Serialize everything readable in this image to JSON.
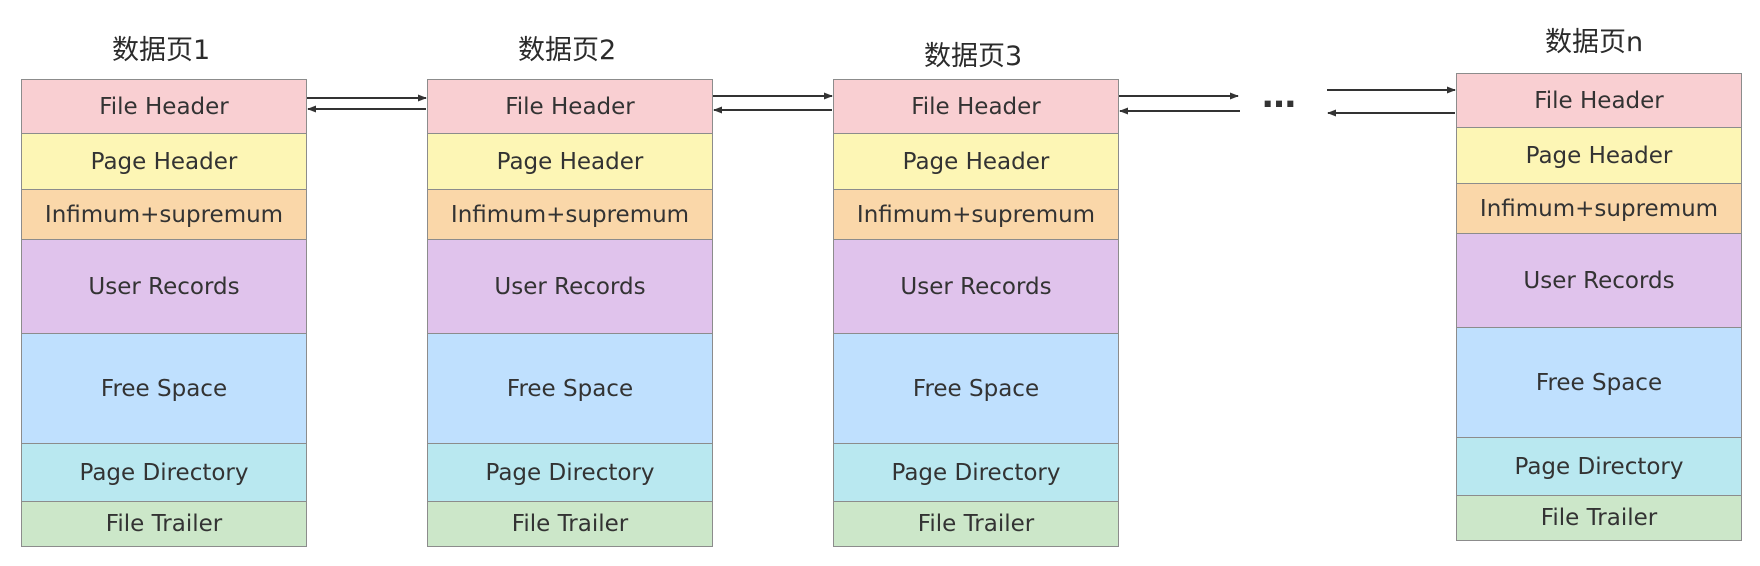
{
  "pages": [
    {
      "title": "数据页1",
      "sections": {
        "file_header": "File Header",
        "page_header": "Page Header",
        "infimum_supremum": "Infimum+supremum",
        "user_records": "User Records",
        "free_space": "Free Space",
        "page_directory": "Page Directory",
        "file_trailer": "File Trailer"
      }
    },
    {
      "title": "数据页2",
      "sections": {
        "file_header": "File Header",
        "page_header": "Page Header",
        "infimum_supremum": "Infimum+supremum",
        "user_records": "User Records",
        "free_space": "Free Space",
        "page_directory": "Page Directory",
        "file_trailer": "File Trailer"
      }
    },
    {
      "title": "数据页3",
      "sections": {
        "file_header": "File Header",
        "page_header": "Page Header",
        "infimum_supremum": "Infimum+supremum",
        "user_records": "User Records",
        "free_space": "Free Space",
        "page_directory": "Page Directory",
        "file_trailer": "File Trailer"
      }
    },
    {
      "title": "数据页n",
      "sections": {
        "file_header": "File Header",
        "page_header": "Page Header",
        "infimum_supremum": "Infimum+supremum",
        "user_records": "User Records",
        "free_space": "Free Space",
        "page_directory": "Page Directory",
        "file_trailer": "File Trailer"
      }
    }
  ],
  "ellipsis": "…",
  "colors": {
    "file_header": "#f9cfd2",
    "page_header": "#fdf6b5",
    "infimum_supremum": "#fad7a9",
    "user_records": "#e0c3ec",
    "free_space": "#bfe0fe",
    "page_directory": "#b9e8f0",
    "file_trailer": "#cce7c9",
    "border": "#8c8c8c",
    "arrow": "#333333"
  }
}
